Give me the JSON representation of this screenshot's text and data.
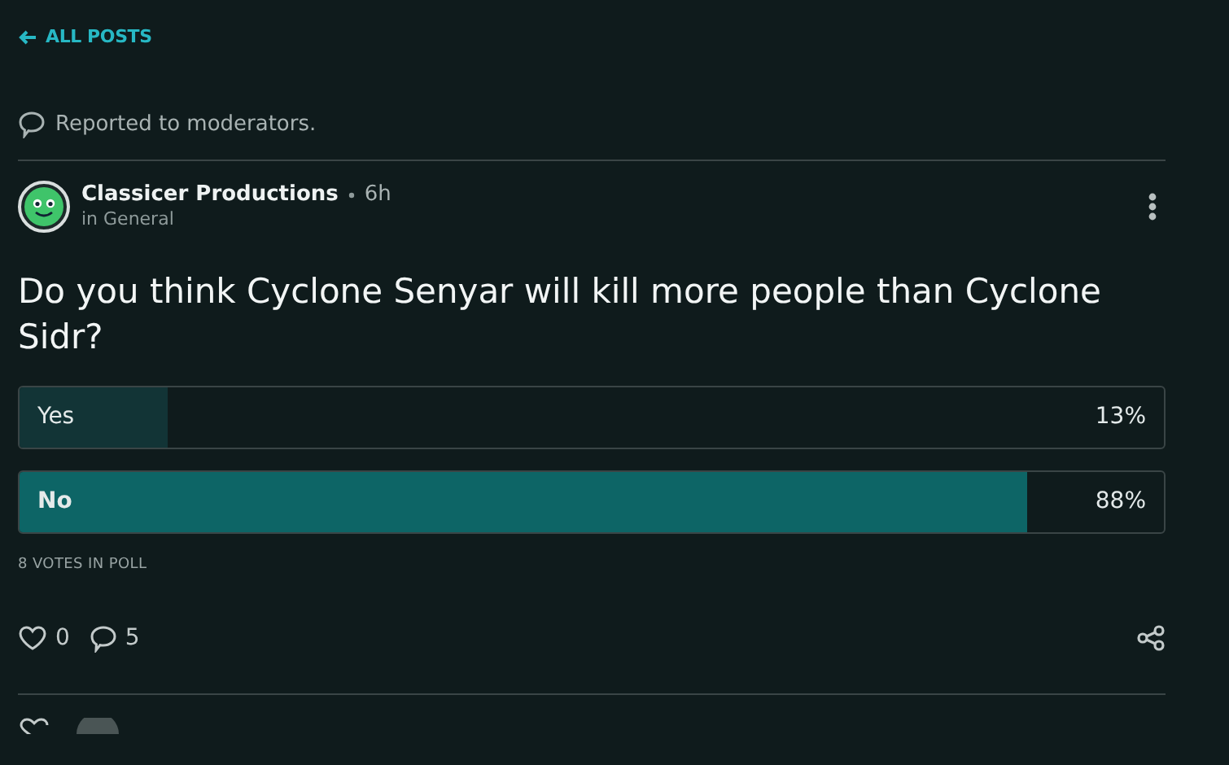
{
  "back_link": {
    "label": "ALL POSTS"
  },
  "notice": {
    "text": "Reported to moderators."
  },
  "post": {
    "author": "Classicer Productions",
    "time": "6h",
    "community": "in General",
    "question": "Do you think Cyclone Senyar will kill more people than Cyclone Sidr?",
    "options": [
      {
        "label": "Yes",
        "percent": "13%",
        "level": 0.13,
        "selected": false
      },
      {
        "label": "No",
        "percent": "88%",
        "level": 0.88,
        "selected": true
      }
    ],
    "votes": "8 VOTES IN POLL",
    "likes": "0",
    "comments": "5"
  }
}
